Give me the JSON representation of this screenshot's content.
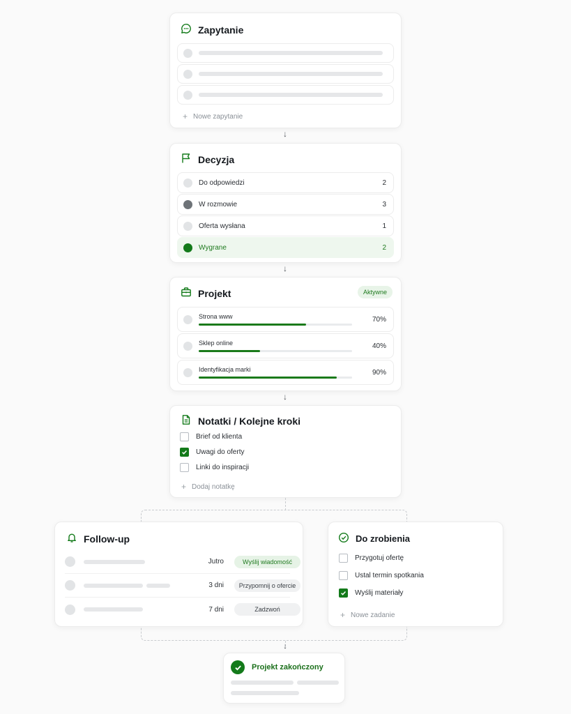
{
  "inquiry": {
    "title": "Zapytanie",
    "add_label": "Nowe zapytanie"
  },
  "decision": {
    "title": "Decyzja",
    "rows": [
      {
        "label": "Do odpowiedzi",
        "count": "2"
      },
      {
        "label": "W rozmowie",
        "count": "3"
      },
      {
        "label": "Oferta wysłana",
        "count": "1"
      },
      {
        "label": "Wygrane",
        "count": "2"
      }
    ]
  },
  "project": {
    "title": "Projekt",
    "badge": "Aktywne",
    "items": [
      {
        "label": "Strona www",
        "percent": "70%",
        "progress": 0.7
      },
      {
        "label": "Sklep online",
        "percent": "40%",
        "progress": 0.4
      },
      {
        "label": "Identyfikacja marki",
        "percent": "90%",
        "progress": 0.9
      }
    ]
  },
  "notes": {
    "title": "Notatki / Kolejne kroki",
    "items": [
      {
        "label": "Brief od klienta",
        "checked": false
      },
      {
        "label": "Uwagi do oferty",
        "checked": true
      },
      {
        "label": "Linki do inspiracji",
        "checked": false
      }
    ],
    "add_label": "Dodaj notatkę"
  },
  "followup": {
    "title": "Follow-up",
    "rows": [
      {
        "when": "Jutro",
        "action": "Wyślij wiadomość"
      },
      {
        "when": "3 dni",
        "action": "Przypomnij o ofercie"
      },
      {
        "when": "7 dni",
        "action": "Zadzwoń"
      }
    ]
  },
  "todo": {
    "title": "Do zrobienia",
    "items": [
      {
        "label": "Przygotuj ofertę",
        "checked": false
      },
      {
        "label": "Ustal termin spotkania",
        "checked": false
      },
      {
        "label": "Wyślij materiały",
        "checked": true
      }
    ],
    "add_label": "Nowe zadanie"
  },
  "done": {
    "title": "Projekt zakończony"
  },
  "colors": {
    "accent": "#137a1a",
    "accent_light": "#e8f4e8",
    "won_row_bg": "#eef7ee",
    "placeholder": "#e6e7e9"
  },
  "icons": {
    "inquiry": "chat-bubble-icon",
    "decision": "flag-icon",
    "project": "briefcase-icon",
    "notes": "document-icon",
    "followup": "bell-icon",
    "todo": "check-circle-icon",
    "done": "check-badge-icon"
  }
}
